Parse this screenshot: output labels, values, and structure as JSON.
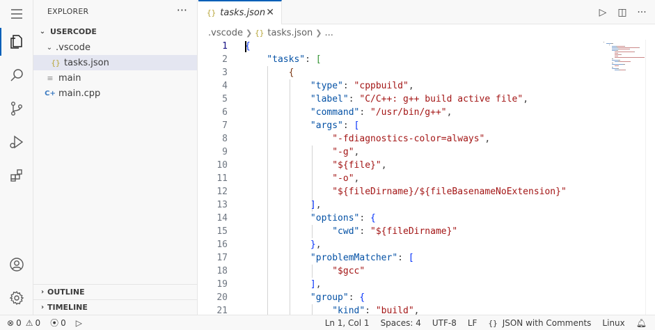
{
  "activity_bar": {
    "items": [
      {
        "name": "menu-icon"
      },
      {
        "name": "explorer-icon"
      },
      {
        "name": "search-icon"
      },
      {
        "name": "source-control-icon"
      },
      {
        "name": "run-debug-icon"
      },
      {
        "name": "extensions-icon"
      },
      {
        "name": "account-icon"
      },
      {
        "name": "manage-gear-icon"
      }
    ],
    "active_color": "#005fb8"
  },
  "sidebar": {
    "title": "EXPLORER",
    "more": "···",
    "workspace": "USERCODE",
    "tree": [
      {
        "label": ".vscode",
        "icon": "chevron-down-icon"
      },
      {
        "label": "tasks.json",
        "icon": "json-file-icon",
        "icon_text": "{}"
      },
      {
        "label": "main",
        "icon": "binary-file-icon",
        "icon_text": "≡"
      },
      {
        "label": "main.cpp",
        "icon": "cpp-file-icon",
        "icon_text": "C+"
      }
    ],
    "outline": "OUTLINE",
    "timeline": "TIMELINE"
  },
  "tabs": [
    {
      "label": "tasks.json",
      "icon_text": "{}",
      "close": "✕"
    }
  ],
  "editor_actions": {
    "run": "▷",
    "split": "◫",
    "more": "···"
  },
  "breadcrumb": {
    "folder": ".vscode",
    "file_icon": "{}",
    "file": "tasks.json",
    "more": "..."
  },
  "editor": {
    "lines": [
      {
        "n": "1",
        "parts": [
          {
            "t": "{",
            "c": "br1"
          }
        ]
      },
      {
        "n": "2",
        "parts": [
          {
            "t": "    ",
            "c": ""
          },
          {
            "t": "\"tasks\"",
            "c": "t-key"
          },
          {
            "t": ": ",
            "c": "t-punc"
          },
          {
            "t": "[",
            "c": "br2"
          }
        ]
      },
      {
        "n": "3",
        "parts": [
          {
            "t": "        ",
            "c": ""
          },
          {
            "t": "{",
            "c": "br3"
          }
        ]
      },
      {
        "n": "4",
        "parts": [
          {
            "t": "            ",
            "c": ""
          },
          {
            "t": "\"type\"",
            "c": "t-key"
          },
          {
            "t": ": ",
            "c": "t-punc"
          },
          {
            "t": "\"cppbuild\"",
            "c": "t-str"
          },
          {
            "t": ",",
            "c": "t-punc"
          }
        ]
      },
      {
        "n": "5",
        "parts": [
          {
            "t": "            ",
            "c": ""
          },
          {
            "t": "\"label\"",
            "c": "t-key"
          },
          {
            "t": ": ",
            "c": "t-punc"
          },
          {
            "t": "\"C/C++: g++ build active file\"",
            "c": "t-str"
          },
          {
            "t": ",",
            "c": "t-punc"
          }
        ]
      },
      {
        "n": "6",
        "parts": [
          {
            "t": "            ",
            "c": ""
          },
          {
            "t": "\"command\"",
            "c": "t-key"
          },
          {
            "t": ": ",
            "c": "t-punc"
          },
          {
            "t": "\"/usr/bin/g++\"",
            "c": "t-str"
          },
          {
            "t": ",",
            "c": "t-punc"
          }
        ]
      },
      {
        "n": "7",
        "parts": [
          {
            "t": "            ",
            "c": ""
          },
          {
            "t": "\"args\"",
            "c": "t-key"
          },
          {
            "t": ": ",
            "c": "t-punc"
          },
          {
            "t": "[",
            "c": "br1"
          }
        ]
      },
      {
        "n": "8",
        "parts": [
          {
            "t": "                ",
            "c": ""
          },
          {
            "t": "\"-fdiagnostics-color=always\"",
            "c": "t-str"
          },
          {
            "t": ",",
            "c": "t-punc"
          }
        ]
      },
      {
        "n": "9",
        "parts": [
          {
            "t": "                ",
            "c": ""
          },
          {
            "t": "\"-g\"",
            "c": "t-str"
          },
          {
            "t": ",",
            "c": "t-punc"
          }
        ]
      },
      {
        "n": "10",
        "parts": [
          {
            "t": "                ",
            "c": ""
          },
          {
            "t": "\"${file}\"",
            "c": "t-str"
          },
          {
            "t": ",",
            "c": "t-punc"
          }
        ]
      },
      {
        "n": "11",
        "parts": [
          {
            "t": "                ",
            "c": ""
          },
          {
            "t": "\"-o\"",
            "c": "t-str"
          },
          {
            "t": ",",
            "c": "t-punc"
          }
        ]
      },
      {
        "n": "12",
        "parts": [
          {
            "t": "                ",
            "c": ""
          },
          {
            "t": "\"${fileDirname}/${fileBasenameNoExtension}\"",
            "c": "t-str"
          }
        ]
      },
      {
        "n": "13",
        "parts": [
          {
            "t": "            ",
            "c": ""
          },
          {
            "t": "]",
            "c": "br1"
          },
          {
            "t": ",",
            "c": "t-punc"
          }
        ]
      },
      {
        "n": "14",
        "parts": [
          {
            "t": "            ",
            "c": ""
          },
          {
            "t": "\"options\"",
            "c": "t-key"
          },
          {
            "t": ": ",
            "c": "t-punc"
          },
          {
            "t": "{",
            "c": "br1"
          }
        ]
      },
      {
        "n": "15",
        "parts": [
          {
            "t": "                ",
            "c": ""
          },
          {
            "t": "\"cwd\"",
            "c": "t-key"
          },
          {
            "t": ": ",
            "c": "t-punc"
          },
          {
            "t": "\"${fileDirname}\"",
            "c": "t-str"
          }
        ]
      },
      {
        "n": "16",
        "parts": [
          {
            "t": "            ",
            "c": ""
          },
          {
            "t": "}",
            "c": "br1"
          },
          {
            "t": ",",
            "c": "t-punc"
          }
        ]
      },
      {
        "n": "17",
        "parts": [
          {
            "t": "            ",
            "c": ""
          },
          {
            "t": "\"problemMatcher\"",
            "c": "t-key"
          },
          {
            "t": ": ",
            "c": "t-punc"
          },
          {
            "t": "[",
            "c": "br1"
          }
        ]
      },
      {
        "n": "18",
        "parts": [
          {
            "t": "                ",
            "c": ""
          },
          {
            "t": "\"$gcc\"",
            "c": "t-str"
          }
        ]
      },
      {
        "n": "19",
        "parts": [
          {
            "t": "            ",
            "c": ""
          },
          {
            "t": "]",
            "c": "br1"
          },
          {
            "t": ",",
            "c": "t-punc"
          }
        ]
      },
      {
        "n": "20",
        "parts": [
          {
            "t": "            ",
            "c": ""
          },
          {
            "t": "\"group\"",
            "c": "t-key"
          },
          {
            "t": ": ",
            "c": "t-punc"
          },
          {
            "t": "{",
            "c": "br1"
          }
        ]
      },
      {
        "n": "21",
        "parts": [
          {
            "t": "                ",
            "c": ""
          },
          {
            "t": "\"kind\"",
            "c": "t-key"
          },
          {
            "t": ": ",
            "c": "t-punc"
          },
          {
            "t": "\"build\"",
            "c": "t-str"
          },
          {
            "t": ",",
            "c": "t-punc"
          }
        ]
      }
    ]
  },
  "statusbar": {
    "errors": "0",
    "warnings": "0",
    "ports": "0",
    "position": "Ln 1, Col 1",
    "spaces": "Spaces: 4",
    "encoding": "UTF-8",
    "eol": "LF",
    "language_icon": "{}",
    "language": "JSON with Comments",
    "os": "Linux"
  }
}
